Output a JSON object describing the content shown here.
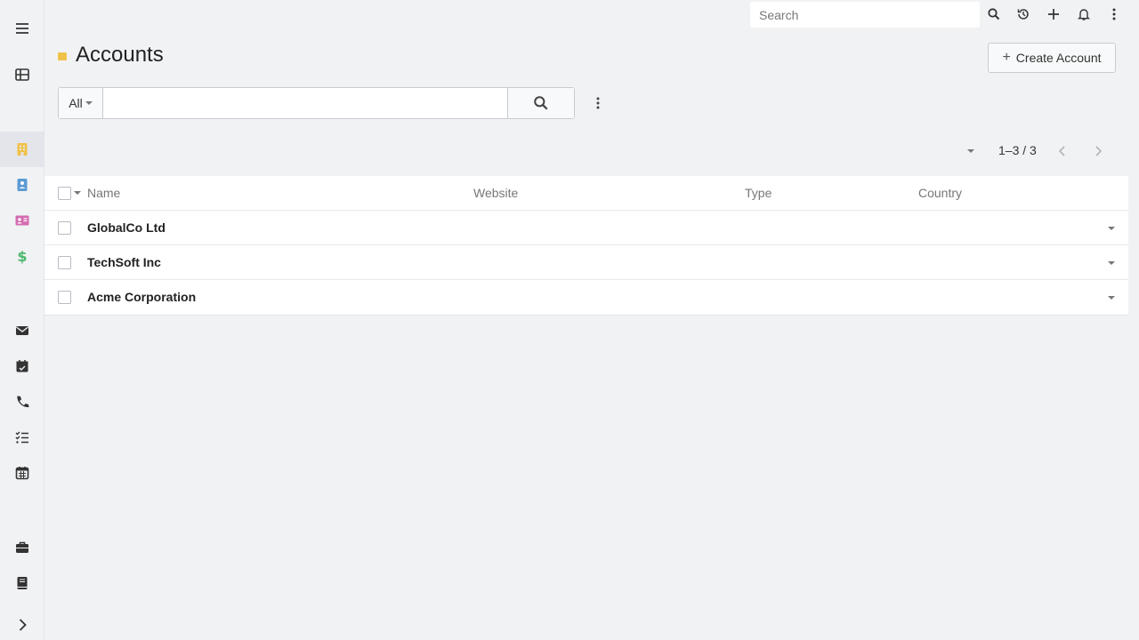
{
  "topbar": {
    "search_placeholder": "Search",
    "icons": [
      "search-icon",
      "history-icon",
      "plus-icon",
      "bell-icon",
      "more-vertical-icon"
    ]
  },
  "sidebar": {
    "items": [
      {
        "name": "menu-icon"
      },
      {
        "name": "dashboard-icon"
      },
      {
        "name": "accounts-icon",
        "color": "#f0c24a",
        "active": true
      },
      {
        "name": "contacts-icon",
        "color": "#5b9bd5"
      },
      {
        "name": "leads-icon",
        "color": "#d46bb0"
      },
      {
        "name": "opportunities-icon",
        "color": "#4cb86e"
      },
      {
        "name": "email-icon"
      },
      {
        "name": "meetings-icon"
      },
      {
        "name": "calls-icon"
      },
      {
        "name": "tasks-icon"
      },
      {
        "name": "calendar-icon"
      },
      {
        "name": "cases-icon"
      },
      {
        "name": "knowledge-base-icon"
      },
      {
        "name": "expand-icon"
      }
    ]
  },
  "header": {
    "title": "Accounts",
    "accent_color": "#f0c24a",
    "create_label": "Create Account",
    "create_plus": "+"
  },
  "filter": {
    "scope_label": "All",
    "text_value": "",
    "text_placeholder": ""
  },
  "pagination": {
    "range": "1–3 / 3"
  },
  "table": {
    "columns": [
      "Name",
      "Website",
      "Type",
      "Country"
    ],
    "rows": [
      {
        "name": "GlobalCo Ltd",
        "website": "",
        "type": "",
        "country": ""
      },
      {
        "name": "TechSoft Inc",
        "website": "",
        "type": "",
        "country": ""
      },
      {
        "name": "Acme Corporation",
        "website": "",
        "type": "",
        "country": ""
      }
    ]
  }
}
